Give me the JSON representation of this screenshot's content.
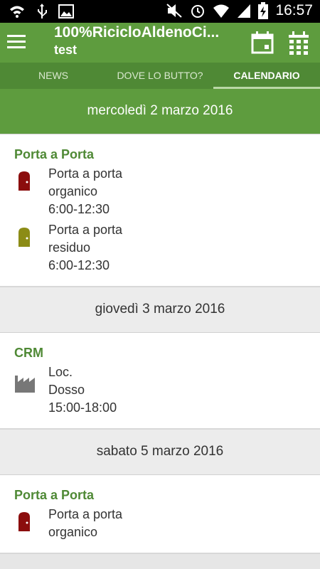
{
  "status_bar": {
    "time": "16:57"
  },
  "app_bar": {
    "title": "100%RicicloAldenoCi...",
    "subtitle": "test"
  },
  "tabs": [
    {
      "label": "NEWS"
    },
    {
      "label": "DOVE LO BUTTO?"
    },
    {
      "label": "CALENDARIO"
    }
  ],
  "days": [
    {
      "date": "mercoledì 2 marzo 2016",
      "group": "Porta a Porta",
      "entries": [
        {
          "text": "Porta a porta\norganico\n6:00-12:30",
          "icon": "door-icon",
          "color": "#8b0d0d"
        },
        {
          "text": "Porta a porta\nresiduo\n6:00-12:30",
          "icon": "door-icon",
          "color": "#8c8c16"
        }
      ]
    },
    {
      "date": "giovedì 3 marzo 2016",
      "group": "CRM",
      "entries": [
        {
          "text": "Loc.\nDosso\n15:00-18:00",
          "icon": "factory-icon",
          "color": "#777777"
        }
      ]
    },
    {
      "date": "sabato 5 marzo 2016",
      "group": "Porta a Porta",
      "entries": [
        {
          "text": "Porta a porta\norganico",
          "icon": "door-icon",
          "color": "#8b0d0d"
        }
      ]
    }
  ],
  "colors": {
    "primary": "#5e9c3e",
    "primary_dark": "#4f8935",
    "accent_text": "#4f8935"
  }
}
